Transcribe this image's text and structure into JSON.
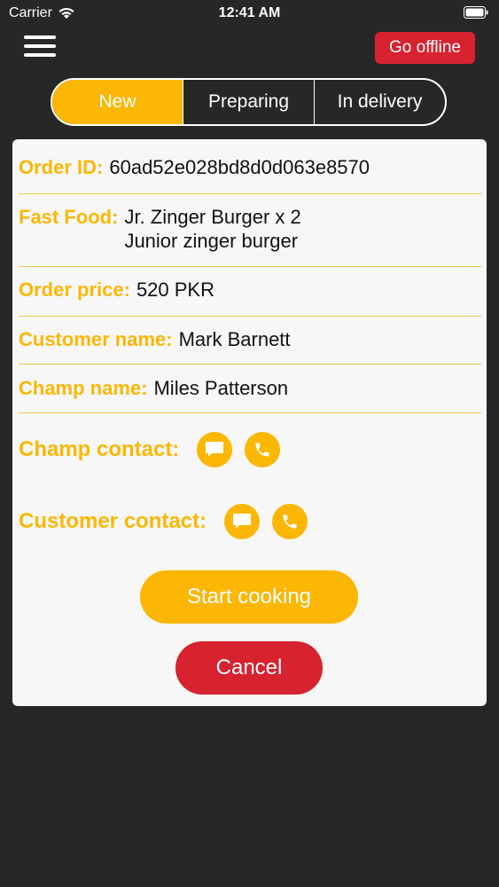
{
  "status_bar": {
    "carrier": "Carrier",
    "time": "12:41 AM"
  },
  "header": {
    "menu_icon": "hamburger-menu-icon",
    "offline_label": "Go offline"
  },
  "tabs": [
    {
      "label": "New",
      "active": true
    },
    {
      "label": "Preparing",
      "active": false
    },
    {
      "label": "In delivery",
      "active": false
    }
  ],
  "order": {
    "id_label": "Order ID:",
    "id_value": "60ad52e028bd8d0d063e8570",
    "food_label": "Fast Food:",
    "food_lines": [
      "Jr. Zinger Burger x 2",
      "Junior zinger burger"
    ],
    "price_label": "Order price:",
    "price_value": "520 PKR",
    "customer_label": "Customer name:",
    "customer_value": "Mark Barnett",
    "champ_label": "Champ name:",
    "champ_value": "Miles Patterson"
  },
  "contacts": {
    "champ_label": "Champ contact:",
    "customer_label": "Customer contact:",
    "message_icon": "message-icon",
    "phone_icon": "phone-icon"
  },
  "actions": {
    "start_label": "Start cooking",
    "cancel_label": "Cancel"
  },
  "colors": {
    "accent": "#fbb704",
    "danger": "#d7222f",
    "background": "#272727",
    "card": "#f7f7f7"
  }
}
